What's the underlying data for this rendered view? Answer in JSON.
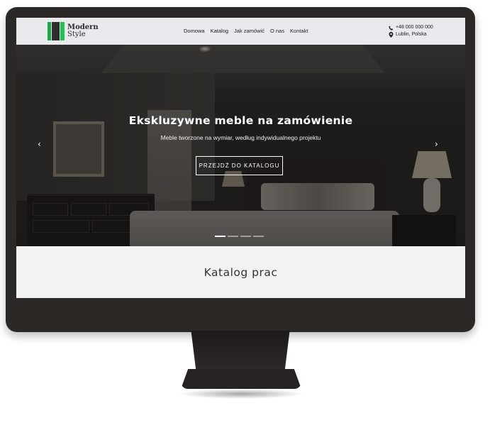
{
  "logo": {
    "line1": "Modern",
    "line2": "Style"
  },
  "nav": {
    "items": [
      "Domowa",
      "Katalog",
      "Jak zamówić",
      "O nas",
      "Kontakt"
    ]
  },
  "contact": {
    "phone": "+48 000 000 000",
    "location": "Lublin, Polska",
    "phone_icon": "phone-icon",
    "location_icon": "map-marker-icon"
  },
  "hero": {
    "title": "Ekskluzywne meble na zamówienie",
    "subtitle": "Meble tworzone na wymiar, według indywidualnego projektu",
    "cta": "PRZEJDŹ DO KATALOGU",
    "prev_arrow": "‹",
    "next_arrow": "›",
    "slides": 4,
    "active_slide": 1
  },
  "section": {
    "title": "Katalog prac"
  },
  "colors": {
    "monitor": "#2b2826",
    "header_bg": "#e9e9ee",
    "logo_green": "#1fa64a",
    "hero_overlay": "#000000"
  }
}
